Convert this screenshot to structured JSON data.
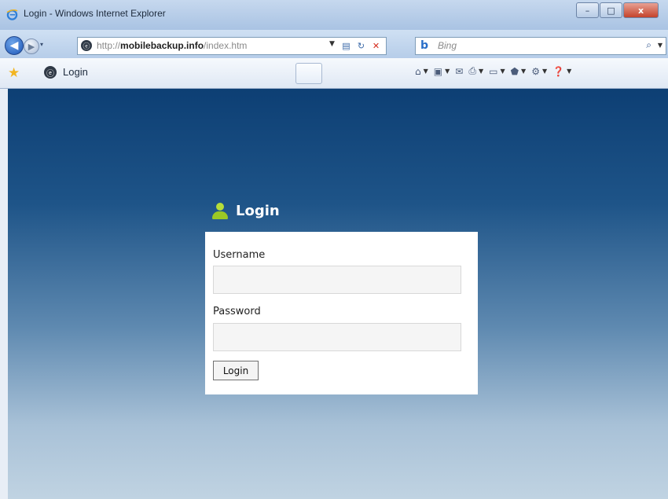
{
  "window": {
    "title": "Login - Windows Internet Explorer",
    "min_glyph": "–",
    "max_glyph": "□",
    "close_glyph": "x"
  },
  "nav": {
    "back_glyph": "◀",
    "forward_glyph": "▶",
    "history_glyph": "▾",
    "address": {
      "prefix": "http://",
      "domain": "mobilebackup.info",
      "path": "/index.htm"
    },
    "search_placeholder": "Bing",
    "search_logo": "b",
    "search_go_glyph": "⌕"
  },
  "tab": {
    "label": "Login"
  },
  "page": {
    "heading": "Login",
    "username_label": "Username",
    "username_value": "",
    "password_label": "Password",
    "password_value": "",
    "submit_label": "Login"
  },
  "icons": {
    "back": "back-arrow-icon",
    "forward": "forward-arrow-icon",
    "favorites": "star-icon",
    "user": "user-icon",
    "home": "home-icon",
    "feeds": "feeds-icon",
    "mail": "mail-icon",
    "print": "print-icon",
    "page": "page-icon",
    "safety": "safety-icon",
    "tools": "tools-icon",
    "help": "help-icon"
  },
  "colors": {
    "page_top": "#0d3f74",
    "page_bottom": "#c0d3e2",
    "user_icon": "#9cc825",
    "stop": "#d42b1c"
  }
}
